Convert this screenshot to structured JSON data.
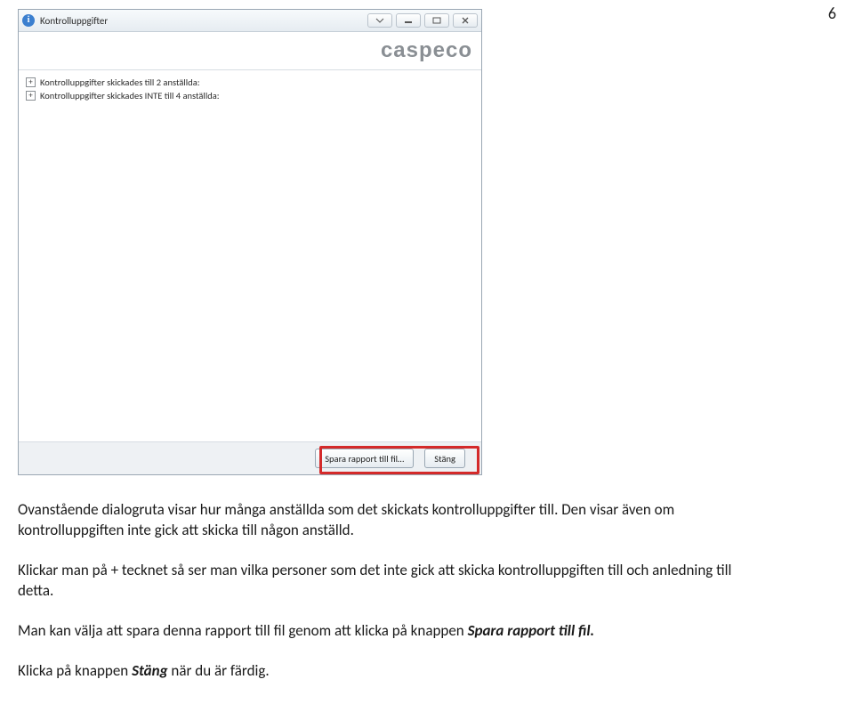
{
  "page_number": "6",
  "window": {
    "title": "Kontrolluppgifter",
    "brand": "caspeco",
    "tree_rows": [
      "Kontrolluppgifter skickades till 2 anställda:",
      "Kontrolluppgifter skickades INTE till 4 anställda:"
    ],
    "buttons": {
      "save": "Spara rapport till fil…",
      "close": "Stäng"
    }
  },
  "text": {
    "p1a": "Ovanstående dialogruta visar hur många anställda som det skickats kontrolluppgifter till. Den visar även om kontrolluppgiften inte gick att skicka till någon anställd.",
    "p2a": "Klickar man på + tecknet så ser man vilka personer som det inte gick att skicka kontrolluppgiften till och anledning till detta.",
    "p3_pre": "Man kan välja att spara denna rapport till fil genom att klicka på knappen ",
    "p3_bi": "Spara rapport till fil.",
    "p4_pre": "Klicka på knappen ",
    "p4_bi": "Stäng",
    "p4_post": " när du är färdig."
  }
}
